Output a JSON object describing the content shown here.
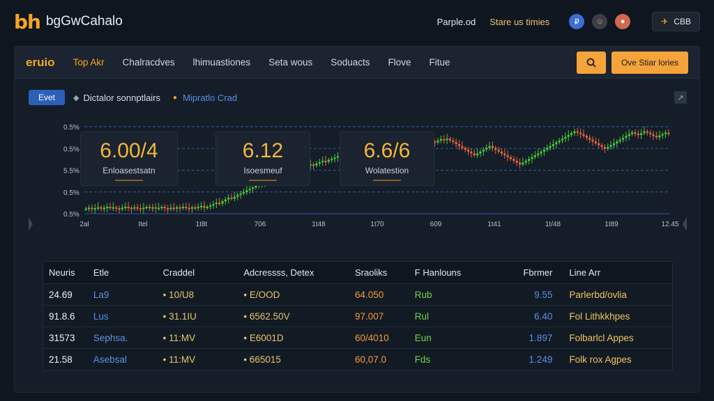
{
  "topbar": {
    "logo": "bh",
    "brand": "bgGwCahalo",
    "links": [
      "Parple.od",
      "Stare us timies"
    ],
    "lang_button": "CBB"
  },
  "nav": {
    "logo_text": "eruio",
    "items": [
      "Top Akr",
      "Chalracdves",
      "lhimuastiones",
      "Seta wous",
      "Soduacts",
      "Flove",
      "Fitue"
    ],
    "cta_label": "Ove Stiar lories"
  },
  "subbar": {
    "event_label": "Evet",
    "text": "Dictalor sonnptlairs",
    "link": "Mipratlo Crad"
  },
  "stats": [
    {
      "value": "6.00/4",
      "label": "Enloasestsatn"
    },
    {
      "value": "6.12",
      "label": "Isoesmeuf"
    },
    {
      "value": "6.6/6",
      "label": "Wolatestion"
    }
  ],
  "chart_data": {
    "type": "candlestick",
    "y_tick_labels": [
      "0.5%",
      "0.5%",
      "5.5%",
      "0.5%",
      "0.5%"
    ],
    "x_tick_labels": [
      "2al",
      "Itel",
      "1t8t",
      "706",
      "1t48",
      "1t70",
      "609",
      "1t41",
      "1t/48",
      "1t89",
      "12.45"
    ],
    "colors": {
      "up": "#4cc93a",
      "down": "#e8663e",
      "gridline": "#2e5aa8"
    },
    "close_series": [
      0.62,
      0.64,
      0.61,
      0.63,
      0.65,
      0.62,
      0.64,
      0.66,
      0.63,
      0.65,
      0.63,
      0.61,
      0.64,
      0.66,
      0.64,
      0.62,
      0.65,
      0.63,
      0.61,
      0.64,
      0.66,
      0.63,
      0.65,
      0.62,
      0.64,
      0.66,
      0.63,
      0.61,
      0.64,
      0.62,
      0.65,
      0.63,
      0.66,
      0.64,
      0.62,
      0.65,
      0.63,
      0.66,
      0.68,
      0.64,
      0.66,
      0.69,
      0.72,
      0.75,
      0.73,
      0.78,
      0.82,
      0.86,
      0.84,
      0.88,
      0.92,
      0.95,
      0.98,
      1.02,
      1.05,
      1.08,
      1.12,
      1.15,
      1.18,
      1.22,
      1.25,
      1.28,
      1.31,
      1.34,
      1.37,
      1.4,
      1.44,
      1.46,
      1.43,
      1.47,
      1.5,
      1.48,
      1.52,
      1.55,
      1.58,
      1.56,
      1.6,
      1.63,
      1.66,
      1.64,
      1.68,
      1.7,
      1.73,
      1.76,
      1.74,
      1.78,
      1.76,
      1.73,
      1.7,
      1.73,
      1.76,
      1.78,
      1.81,
      1.84,
      1.87,
      1.9,
      1.93,
      1.96,
      1.99,
      1.96,
      1.93,
      1.9,
      1.93,
      1.96,
      1.99,
      1.95,
      1.92,
      1.96,
      1.99,
      1.97,
      1.94,
      1.98,
      2.02,
      2.05,
      2.08,
      2.06,
      2.1,
      2.13,
      2.11,
      2.14,
      2.1,
      2.07,
      2.02,
      1.98,
      1.94,
      1.9,
      1.86,
      1.82,
      1.78,
      1.82,
      1.86,
      1.9,
      1.94,
      1.98,
      1.94,
      1.9,
      1.86,
      1.82,
      1.78,
      1.74,
      1.7,
      1.66,
      1.62,
      1.58,
      1.62,
      1.66,
      1.7,
      1.74,
      1.78,
      1.82,
      1.86,
      1.9,
      1.94,
      1.98,
      2.02,
      2.06,
      2.1,
      2.14,
      2.18,
      2.22,
      2.26,
      2.3,
      2.27,
      2.24,
      2.2,
      2.16,
      2.12,
      2.08,
      2.04,
      2.0,
      1.96,
      1.92,
      1.96,
      2.0,
      2.04,
      2.08,
      2.12,
      2.16,
      2.2,
      2.24,
      2.28,
      2.25,
      2.22,
      2.26,
      2.3,
      2.27,
      2.24,
      2.2,
      2.17,
      2.21,
      2.24,
      2.27,
      2.24
    ]
  },
  "table": {
    "headers": [
      "Neuris",
      "Etle",
      "Craddel",
      "Adcressss, Detex",
      "Sraoliks",
      "F Hanlouns",
      "Fbrmer",
      "Line Arr"
    ],
    "rows": [
      [
        "24.69",
        "La9",
        "• 10/U8",
        "• E/OOD",
        "64.050",
        "Rub",
        "9.55",
        "Parlerbd/ovlia"
      ],
      [
        "91.8.6",
        "Lus",
        "• 31.1IU",
        "• 6562.50V",
        "97.007",
        "Rul",
        "6.40",
        "Fol Lithkkhpes"
      ],
      [
        "31573",
        "Sephsa.",
        "• 11:MV",
        "• E6001D",
        "60/4010",
        "Eun",
        "1.897",
        "Folbarlcl Appes"
      ],
      [
        "21.58",
        "Asebsal",
        "• 11:MV",
        "• 665015",
        "60,07.0",
        "Fds",
        "1.249",
        "Folk rox Agpes"
      ]
    ]
  }
}
